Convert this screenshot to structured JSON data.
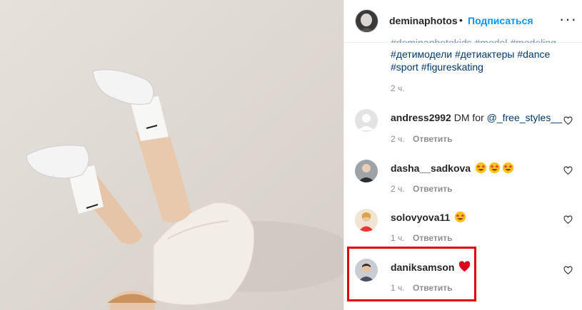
{
  "post": {
    "author": "deminaphotos",
    "separator": "•",
    "follow_label": "Подписаться",
    "more_label": "···",
    "caption_cut": "#deminaphotokids #model #modeling",
    "caption_tags_line1": "#детимодели #детиактеры #dance",
    "caption_tags_line2": "#sport #figureskating",
    "caption_time": "2 ч."
  },
  "comments": [
    {
      "user": "andress2992",
      "text": "DM for ",
      "mention": "@_free_styles__",
      "emoji_count": 0,
      "time": "2 ч.",
      "reply": "Ответить"
    },
    {
      "user": "dasha__sadkova",
      "text": "",
      "mention": "",
      "emoji_count": 3,
      "emoji": "star-struck",
      "time": "2 ч.",
      "reply": "Ответить"
    },
    {
      "user": "solovyova11",
      "text": "",
      "mention": "",
      "emoji_count": 1,
      "emoji": "star-struck",
      "time": "1 ч.",
      "reply": "Ответить"
    },
    {
      "user": "daniksamson",
      "text": "",
      "mention": "",
      "emoji_count": 1,
      "emoji": "red-heart",
      "time": "1 ч.",
      "reply": "Ответить",
      "highlighted": true
    }
  ],
  "colors": {
    "link": "#0095f6",
    "hashtag": "#00376b",
    "meta": "#8e8e8e",
    "highlight": "#e0000e"
  }
}
